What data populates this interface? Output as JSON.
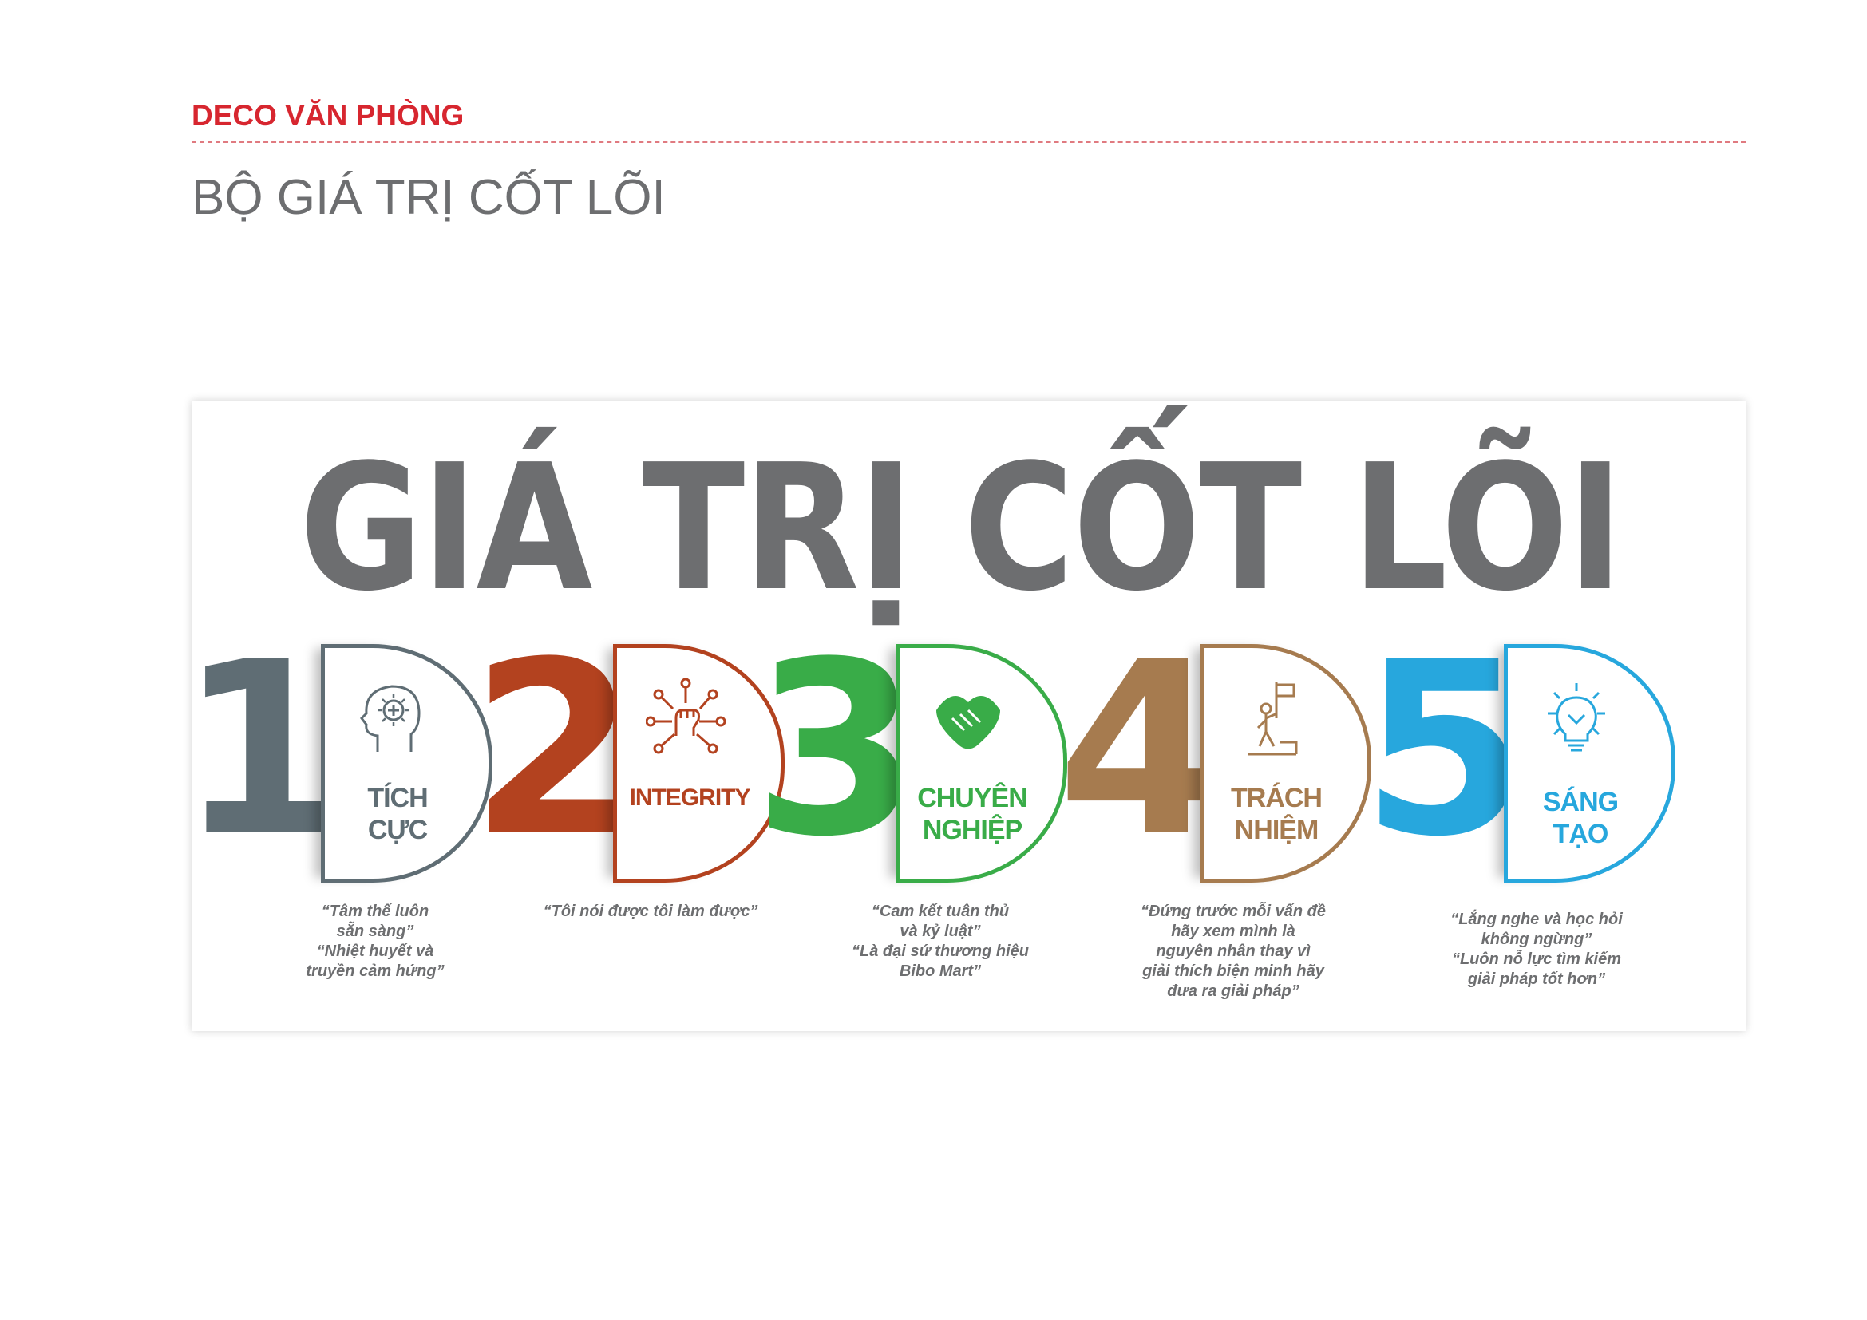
{
  "header": {
    "brand": "DECO VĂN PHÒNG",
    "subtitle": "BỘ GIÁ TRỊ CỐT LÕI"
  },
  "infographic": {
    "title": "GIÁ TRỊ CỐT LÕI",
    "title_color": "#6d6e70",
    "values": [
      {
        "number": "1",
        "color": "#5f6d74",
        "icon": "head-with-plus-icon",
        "label_lines": [
          "TÍCH",
          "CỰC"
        ],
        "quote_lines": [
          "“Tâm thế luôn",
          "sẵn sàng”",
          "“Nhiệt huyết và",
          "truyền cảm hứng”"
        ]
      },
      {
        "number": "2",
        "color": "#b3421f",
        "icon": "fist-network-icon",
        "label_lines": [
          "INTEGRITY"
        ],
        "quote_lines": [
          "“Tôi nói được tôi làm được”"
        ]
      },
      {
        "number": "3",
        "color": "#39ac48",
        "icon": "handshake-icon",
        "label_lines": [
          "CHUYÊN",
          "NGHIỆP"
        ],
        "quote_lines": [
          "“Cam kết tuân thủ",
          "và kỷ luật”",
          "“Là đại sứ thương hiệu",
          "Bibo Mart”"
        ]
      },
      {
        "number": "4",
        "color": "#a67b4f",
        "icon": "person-with-flag-icon",
        "label_lines": [
          "TRÁCH",
          "NHIỆM"
        ],
        "quote_lines": [
          "“Đứng trước mỗi vấn đề",
          "hãy xem mình là",
          "nguyên nhân thay vì",
          "giải thích biện minh hãy",
          "đưa ra giải pháp”"
        ]
      },
      {
        "number": "5",
        "color": "#27a7dd",
        "icon": "lightbulb-icon",
        "label_lines": [
          "SÁNG",
          "TẠO"
        ],
        "quote_lines": [
          "“Lắng nghe và học hỏi",
          "không ngừng”",
          "“Luôn nỗ lực tìm kiếm",
          "giải pháp tốt hơn”"
        ]
      }
    ]
  }
}
